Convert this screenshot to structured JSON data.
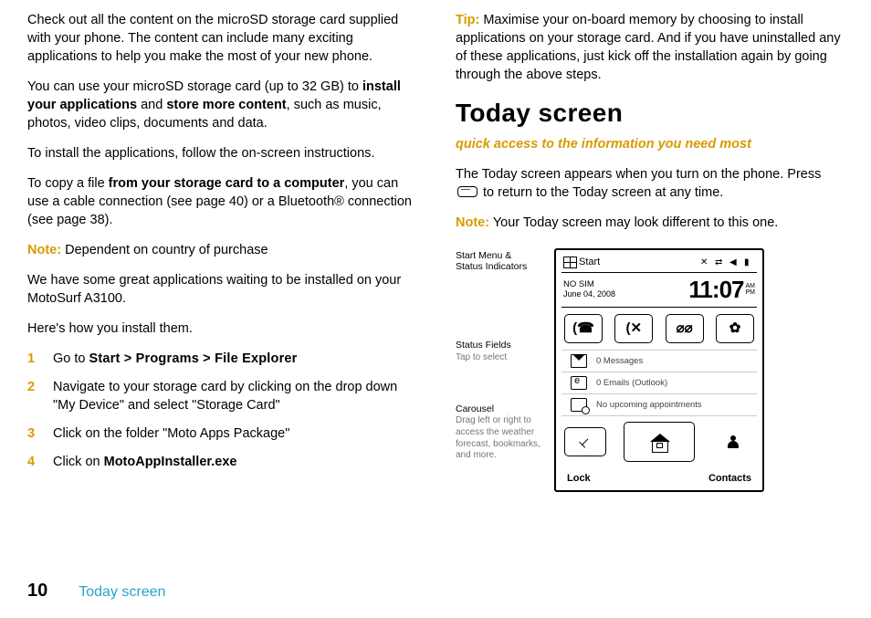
{
  "left": {
    "p1": "Check out all the content on the microSD storage card supplied with your phone. The content can include many exciting applications to help you make the most of your new phone.",
    "p2a": "You can use your microSD storage card (up to 32 GB) to ",
    "p2b": "install your applications",
    "p2c": " and ",
    "p2d": "store more content",
    "p2e": ", such as music, photos, video clips, documents and data.",
    "p3": "To install the applications, follow the on-screen instructions.",
    "p4a": "To copy a file ",
    "p4b": "from your storage card to a computer",
    "p4c": ", you can use a cable connection (see page 40) or a Bluetooth® connection (see page 38).",
    "note": "Note:",
    "note_t": " Dependent on country of purchase",
    "p5": "We have some great applications waiting to be installed on your MotoSurf A3100.",
    "p6": "Here's how you install them.",
    "s1a": "Go to ",
    "s1b": "Start > Programs > File Explorer",
    "s2": "Navigate to your storage card by clicking on the drop down \"My Device\" and select \"Storage Card\"",
    "s3": "Click on the folder \"Moto Apps Package\"",
    "s4a": "Click on ",
    "s4b": "MotoAppInstaller.exe"
  },
  "right": {
    "tip": "Tip:",
    "tip_t": " Maximise your on-board memory by choosing to install applications on your storage card. And if you have uninstalled any of these applications, just kick off the installation again by going through the above steps.",
    "h": "Today screen",
    "sub": "quick access to the information you need most",
    "p1a": "The Today screen appears when you turn on the phone. Press ",
    "p1b": " to return to the Today screen at any time.",
    "note": "Note:",
    "note_t": " Your Today screen may look different to this one."
  },
  "labels": {
    "l1a": "Start Menu &",
    "l1b": "Status Indicators",
    "l2a": "Status Fields",
    "l2b": "Tap to select",
    "l3a": "Carousel",
    "l3b": "Drag left or right to access the weather forecast, bookmarks, and more."
  },
  "phone": {
    "start": "Start",
    "nosim": "NO SIM",
    "date": "June 04, 2008",
    "time": "11:07",
    "am": "AM",
    "pm": "PM",
    "msgs": "0 Messages",
    "emails": "0 Emails (Outlook)",
    "appt": "No upcoming appointments",
    "lock": "Lock",
    "contacts": "Contacts"
  },
  "footer": {
    "page": "10",
    "title": "Today screen"
  }
}
